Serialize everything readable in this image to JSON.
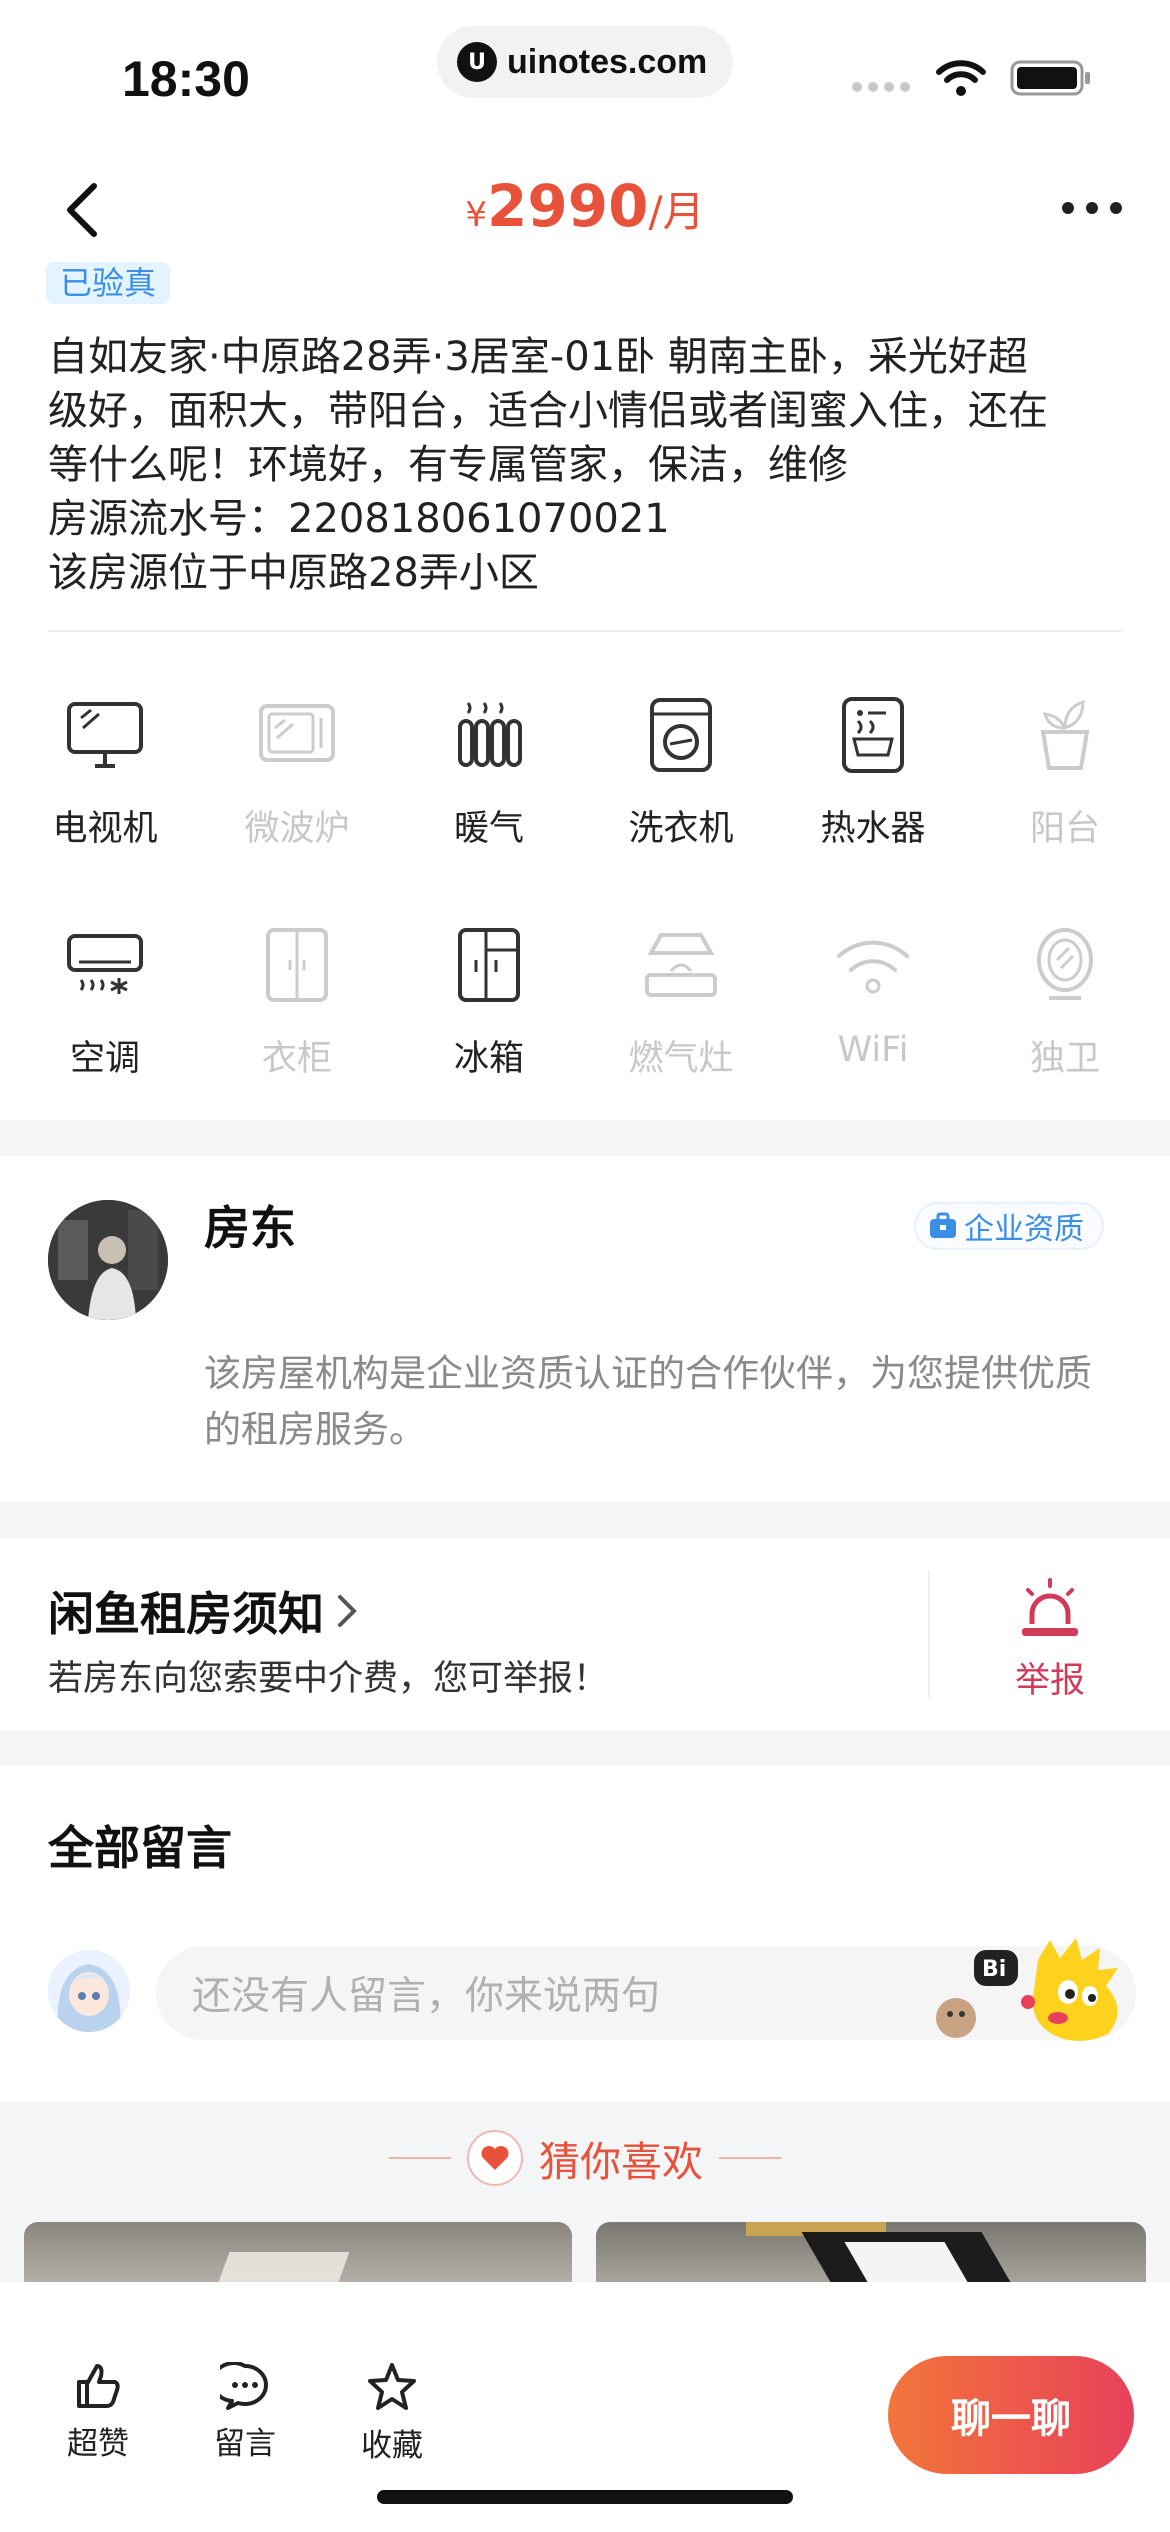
{
  "status_bar": {
    "time": "18:30",
    "url": "uinotes.com"
  },
  "header": {
    "currency": "¥",
    "amount": "2990",
    "unit": "/月"
  },
  "verified_tag": "已验真",
  "description": {
    "lines": [
      "自如友家·中原路28弄·3居室-01卧 朝南主卧，采光好超",
      "级好，面积大，带阳台，适合小情侣或者闺蜜入住，还在",
      "等什么呢！环境好，有专属管家，保洁，维修",
      "房源流水号：220818061070021",
      "该房源位于中原路28弄小区"
    ]
  },
  "amenities": [
    {
      "label": "电视机",
      "icon": "tv-icon",
      "available": true
    },
    {
      "label": "微波炉",
      "icon": "microwave-icon",
      "available": false
    },
    {
      "label": "暖气",
      "icon": "heater-icon",
      "available": true
    },
    {
      "label": "洗衣机",
      "icon": "washing-machine-icon",
      "available": true
    },
    {
      "label": "热水器",
      "icon": "water-heater-icon",
      "available": true
    },
    {
      "label": "阳台",
      "icon": "balcony-plant-icon",
      "available": false
    },
    {
      "label": "空调",
      "icon": "air-conditioner-icon",
      "available": true
    },
    {
      "label": "衣柜",
      "icon": "wardrobe-icon",
      "available": false
    },
    {
      "label": "冰箱",
      "icon": "fridge-icon",
      "available": true
    },
    {
      "label": "燃气灶",
      "icon": "gas-stove-icon",
      "available": false
    },
    {
      "label": "WiFi",
      "icon": "wifi-icon",
      "available": false
    },
    {
      "label": "独卫",
      "icon": "bathroom-mirror-icon",
      "available": false
    }
  ],
  "landlord": {
    "name": "房东",
    "badge": "企业资质",
    "description": "该房屋机构是企业资质认证的合作伙伴，为您提供优质的租房服务。"
  },
  "notice": {
    "title": "闲鱼租房须知",
    "subtitle": "若房东向您索要中介费，您可举报！",
    "report_label": "举报"
  },
  "comments": {
    "title": "全部留言",
    "placeholder": "还没有人留言，你来说两句"
  },
  "recommend": {
    "title": "猜你喜欢"
  },
  "bottom_bar": {
    "like": "超赞",
    "comment": "留言",
    "favorite": "收藏",
    "chat": "聊一聊"
  },
  "colors": {
    "accent": "#e8523a",
    "report": "#d23a5a",
    "badge_blue": "#3a8ee6"
  }
}
